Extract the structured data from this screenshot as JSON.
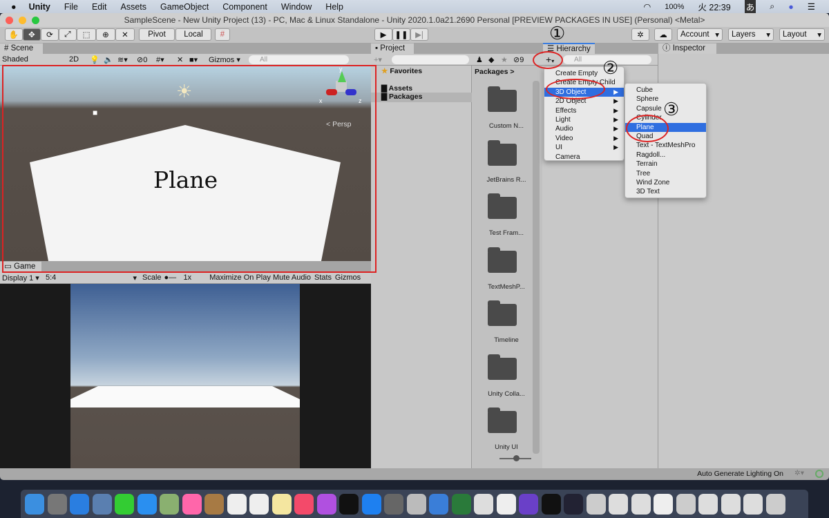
{
  "menubar": {
    "app": "Unity",
    "items": [
      "File",
      "Edit",
      "Assets",
      "GameObject",
      "Component",
      "Window",
      "Help"
    ],
    "battery": "100%",
    "clock": "火 22:39",
    "ime": "あ"
  },
  "window": {
    "title": "SampleScene - New Unity Project (13) - PC, Mac & Linux Standalone - Unity 2020.1.0a21.2690 Personal [PREVIEW PACKAGES IN USE] (Personal) <Metal>"
  },
  "toolbar": {
    "pivot": "Pivot",
    "local": "Local",
    "account": "Account",
    "layers": "Layers",
    "layout": "Layout"
  },
  "scene": {
    "tab": "Scene",
    "shading": "Shaded",
    "mode2d": "2D",
    "hidden_count": "0",
    "gizmos": "Gizmos",
    "search_placeholder": "All",
    "persp": "Persp",
    "axes": {
      "x": "x",
      "y": "y",
      "z": "z"
    }
  },
  "game": {
    "tab": "Game",
    "display": "Display 1",
    "aspect": "5:4",
    "scale_label": "Scale",
    "scale_value": "1x",
    "maximize": "Maximize On Play",
    "mute": "Mute Audio",
    "stats": "Stats",
    "gizmos": "Gizmos"
  },
  "project": {
    "tab": "Project",
    "hidden_count": "9",
    "tree": [
      "Favorites",
      "Assets",
      "Packages"
    ],
    "breadcrumb": "Packages",
    "folders": [
      "Custom N...",
      "JetBrains R...",
      "Test Fram...",
      "TextMeshP...",
      "Timeline",
      "Unity Colla...",
      "Unity UI"
    ]
  },
  "hierarchy": {
    "tab": "Hierarchy",
    "search_placeholder": "All"
  },
  "inspector": {
    "tab": "Inspector"
  },
  "create_menu": {
    "items": [
      "Create Empty",
      "Create Empty Child",
      "3D Object",
      "2D Object",
      "Effects",
      "Light",
      "Audio",
      "Video",
      "UI",
      "Camera"
    ],
    "has_submenu": [
      false,
      false,
      true,
      true,
      true,
      true,
      true,
      true,
      true,
      false
    ],
    "selected": "3D Object"
  },
  "submenu_3d": {
    "items": [
      "Cube",
      "Sphere",
      "Capsule",
      "Cylinder",
      "Plane",
      "Quad",
      "Text - TextMeshPro",
      "Ragdoll...",
      "Terrain",
      "Tree",
      "Wind Zone",
      "3D Text"
    ],
    "selected": "Plane"
  },
  "annotations": {
    "step1": "①",
    "step2": "②",
    "step3": "③",
    "label": "Plane",
    "color": "#d22222"
  },
  "status": {
    "lighting": "Auto Generate Lighting On"
  },
  "colors": {
    "selection": "#2f6ee0",
    "panel": "#cbcbcb"
  }
}
